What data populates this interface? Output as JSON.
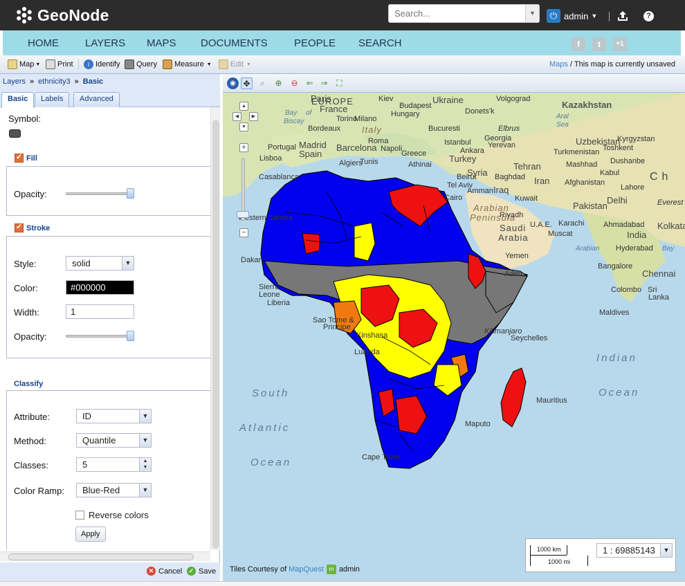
{
  "app": {
    "name": "GeoNode"
  },
  "search": {
    "placeholder": "Search..."
  },
  "user": {
    "name": "admin"
  },
  "nav": [
    "HOME",
    "LAYERS",
    "MAPS",
    "DOCUMENTS",
    "PEOPLE",
    "SEARCH"
  ],
  "social": [
    "f",
    "t",
    "+1"
  ],
  "toolbar": {
    "map": "Map",
    "print": "Print",
    "identify": "Identify",
    "query": "Query",
    "measure": "Measure",
    "edit": "Edit",
    "status_link": "Maps",
    "status_sep": " / ",
    "status_text": "This map is currently unsaved"
  },
  "breadcrumb": {
    "layers": "Layers",
    "layer": "ethnicity3",
    "current": "Basic"
  },
  "tabs": [
    "Basic",
    "Labels",
    "Advanced"
  ],
  "style": {
    "symbol_label": "Symbol:",
    "fill_title": "Fill",
    "fill_opacity_label": "Opacity:",
    "fill_opacity": 1.0,
    "stroke_title": "Stroke",
    "style_label": "Style:",
    "style_value": "solid",
    "color_label": "Color:",
    "color_value": "#000000",
    "width_label": "Width:",
    "width_value": "1",
    "stroke_opacity_label": "Opacity:",
    "stroke_opacity": 1.0
  },
  "classify": {
    "title": "Classify",
    "attribute_label": "Attribute:",
    "attribute_value": "ID",
    "method_label": "Method:",
    "method_value": "Quantile",
    "classes_label": "Classes:",
    "classes_value": "5",
    "ramp_label": "Color Ramp:",
    "ramp_value": "Blue-Red",
    "reverse_label": "Reverse colors",
    "apply_label": "Apply"
  },
  "footer": {
    "cancel": "Cancel",
    "save": "Save"
  },
  "map": {
    "credits_prefix": "Tiles Courtesy of",
    "credits_link": "MapQuest",
    "credits_user": "admin",
    "scale_km": "1000 km",
    "scale_mi": "1000 mi",
    "scale_value": "1 : 69885143",
    "colors": {
      "blue": "#0000ee",
      "red": "#ee1111",
      "yellow": "#ffff00",
      "gray": "#777777",
      "orange": "#f07a10"
    },
    "labels": {
      "europe": "EUROPE",
      "kazakhstan": "Kazakhstan",
      "paris": "Paris",
      "france": "France",
      "volgograd": "Volgograd",
      "ukraine": "Ukraine",
      "kiev": "Kiev",
      "budapest": "Budapest",
      "donets": "Donets'k",
      "hungary": "Hungary",
      "italy": "Italy",
      "bay": "Bay",
      "of": "of",
      "biscay": "Biscay",
      "bordeaux": "Bordeaux",
      "torino": "Torino",
      "milano": "Milano",
      "bucuresti": "Bucuresti",
      "elbrus": "Elbrus",
      "aral": "Aral",
      "sea": "Sea",
      "uzbekistan": "Uzbekistan",
      "portugal": "Portugal",
      "madrid": "Madrid",
      "spain": "Spain",
      "barcelona": "Barcelona",
      "roma": "Roma",
      "napoli": "Napoli",
      "istanbul": "Istanbul",
      "georgia": "Georgia",
      "yerevan": "Yerevan",
      "turkmenistan": "Turkmenistan",
      "toshkent": "Toshkent",
      "kyrgyzstan": "Kyrgyzstan",
      "lisboa": "Lisboa",
      "greece": "Greece",
      "ankara": "Ankara",
      "turkey": "Turkey",
      "athinai": "Athinai",
      "tehran": "Tehran",
      "mashhad": "Mashhad",
      "dushanbe": "Dushanbe",
      "algiers": "Algiers",
      "tunis": "Tunis",
      "syria": "Syria",
      "kabul": "Kabul",
      "casablanca": "Casablanca",
      "beirut": "Beirut",
      "baghdad": "Baghdad",
      "iran": "Iran",
      "afghanistan": "Afghanistan",
      "ch": "Ch",
      "tel_aviv": "Tel Aviv",
      "amman": "Amman",
      "iraq": "Iraq",
      "lahore": "Lahore",
      "cairo": "Cairo",
      "kuwait": "Kuwait",
      "delhi": "Delhi",
      "arabian": "Arabian",
      "peninsula": "Peninsula",
      "pakistan": "Pakistan",
      "everest": "Everest",
      "western_sahara": "Western Sahara",
      "riyadh": "Riyadh",
      "uae": "U.A.E.",
      "karachi": "Karachi",
      "ahmadabad": "Ahmadabad",
      "kolkata": "Kolkata",
      "saudi": "Saudi",
      "arabia": "Arabia",
      "india": "India",
      "muscat": "Muscat",
      "arabian_sea": "Arabian",
      "bay_of": "Bay",
      "hyderabad": "Hyderabad",
      "yemen": "Yemen",
      "aden": "Aden",
      "dakar": "Dakar",
      "bangalore": "Bangalore",
      "chennai": "Chennai",
      "sierra": "Sierra",
      "leone": "Leone",
      "liberia": "Liberia",
      "colombo": "Colombo",
      "sri": "Sri",
      "lanka": "Lanka",
      "maldives": "Maldives",
      "sao_tome": "Sao Tome &",
      "principe": "Principe",
      "kinshasa": "Kinshasa",
      "luanda": "Luanda",
      "seychelles": "Seychelles",
      "indian": "Indian",
      "south": "South",
      "atlantic": "Atlantic",
      "ocean_1": "Ocean",
      "ocean_2": "Ocean",
      "mauritius": "Mauritius",
      "cape_town": "Cape Town",
      "kilimanjaro": "Kilimanjaro",
      "maputo": "Maputo"
    }
  }
}
